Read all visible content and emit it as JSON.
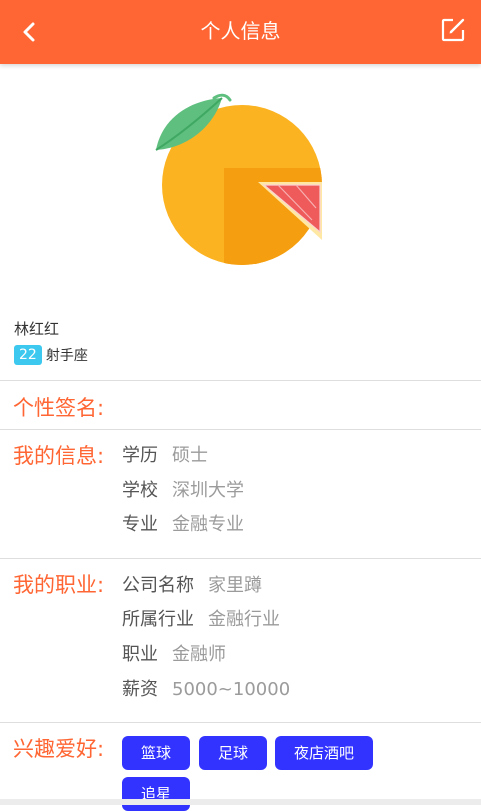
{
  "header": {
    "title": "个人信息",
    "back_icon": "chevron-left-icon",
    "edit_icon": "edit-icon",
    "color": "#ff6633"
  },
  "profile": {
    "name": "林红红",
    "age": "22",
    "zodiac": "射手座",
    "avatar_icon": "orange-fruit-icon"
  },
  "signature": {
    "label": "个性签名:"
  },
  "my_info": {
    "label": "我的信息:",
    "rows": [
      {
        "key": "学历",
        "value": "硕士"
      },
      {
        "key": "学校",
        "value": "深圳大学"
      },
      {
        "key": "专业",
        "value": "金融专业"
      }
    ]
  },
  "career": {
    "label": "我的职业:",
    "rows": [
      {
        "key": "公司名称",
        "value": "家里蹲"
      },
      {
        "key": "所属行业",
        "value": "金融行业"
      },
      {
        "key": "职业",
        "value": "金融师"
      },
      {
        "key": "薪资",
        "value": "5000~10000"
      }
    ]
  },
  "hobbies": {
    "label": "兴趣爱好:",
    "tags": [
      "篮球",
      "足球",
      "夜店酒吧",
      "追星"
    ],
    "tag_color": "#3333ff"
  }
}
